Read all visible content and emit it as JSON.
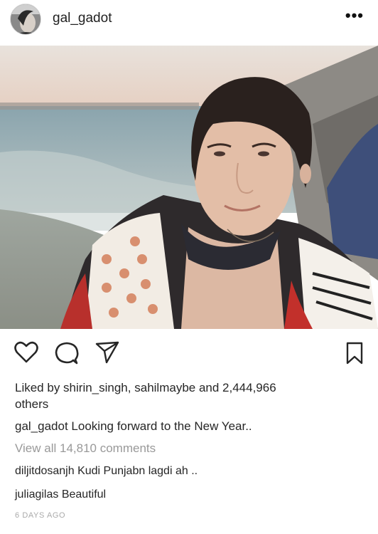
{
  "post": {
    "username": "gal_gadot",
    "more_icon": "more-horizontal-icon"
  },
  "actions": {
    "like_icon": "heart-icon",
    "comment_icon": "comment-icon",
    "share_icon": "send-icon",
    "save_icon": "bookmark-icon"
  },
  "likes": {
    "prefix": "Liked by ",
    "user1": "shirin_singh",
    "sep": ", ",
    "user2": "sahilmaybe",
    "and": " and ",
    "count": "2,444,966",
    "suffix": "others"
  },
  "caption": {
    "username": "gal_gadot",
    "text": "Looking forward to the New Year.."
  },
  "view_all": "View all 14,810 comments",
  "comments": [
    {
      "username": "diljitdosanjh",
      "text": "Kudi Punjabn lagdi ah .."
    },
    {
      "username": "juliagilas",
      "text": "Beautiful"
    }
  ],
  "timestamp": "6 DAYS AGO"
}
